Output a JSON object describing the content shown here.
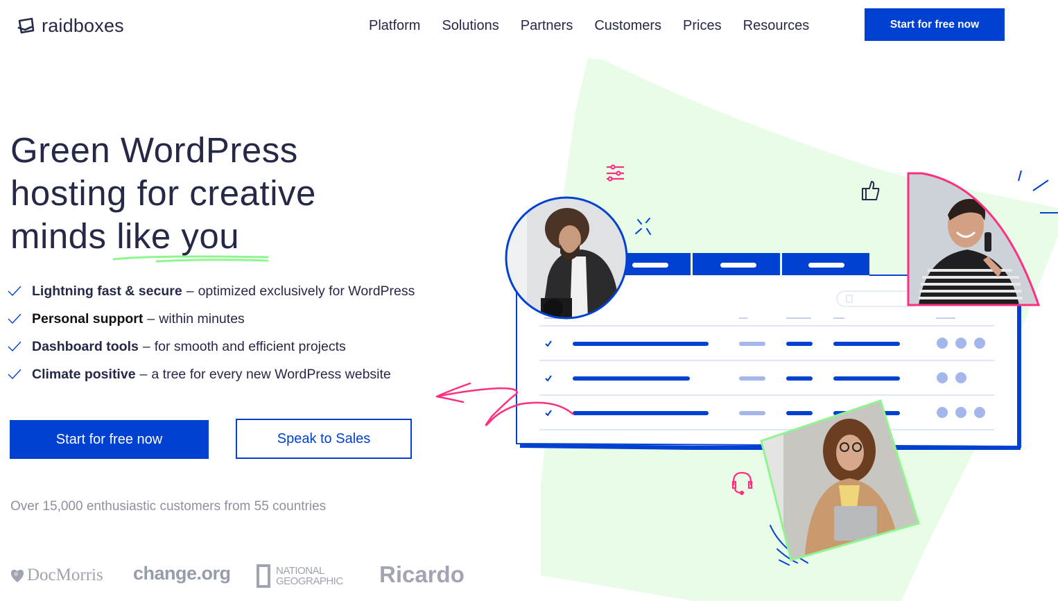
{
  "header": {
    "logo_text": "raidboxes",
    "nav": [
      {
        "label": "Platform"
      },
      {
        "label": "Solutions"
      },
      {
        "label": "Partners"
      },
      {
        "label": "Customers"
      },
      {
        "label": "Prices"
      },
      {
        "label": "Resources"
      }
    ],
    "cta_label": "Start for free now"
  },
  "hero": {
    "title_line1": "Green WordPress",
    "title_line2": "hosting for creative",
    "title_line3_a": "minds ",
    "title_line3_b": "like you",
    "features": [
      {
        "bold": "Lightning fast & secure",
        "rest": "optimized exclusively for WordPress"
      },
      {
        "bold": "Personal support",
        "rest": "within minutes"
      },
      {
        "bold": "Dashboard tools",
        "rest": "for smooth and efficient projects"
      },
      {
        "bold": "Climate positive",
        "rest": "a tree for every new WordPress website"
      }
    ],
    "feature_separator": "–",
    "primary_button": "Start for free now",
    "secondary_button": "Speak to Sales",
    "customers_note": "Over 15,000 enthusiastic customers from 55 countries"
  },
  "customer_logos": {
    "docmorris": "DocMorris",
    "change": "change.org",
    "natgeo_line1": "NATIONAL",
    "natgeo_line2": "GEOGRAPHIC",
    "ricardo": "Ricardo"
  },
  "illustration": {
    "icons": [
      "sliders-icon",
      "thumbs-up-icon",
      "sparkle-icon",
      "headset-icon",
      "arrow-scribble"
    ],
    "dashboard_rows": [
      {
        "checked": true,
        "status_dots": 3
      },
      {
        "checked": true,
        "status_dots": 2
      },
      {
        "checked": true,
        "status_dots": 3
      }
    ],
    "dashboard_tabs": 3
  },
  "colors": {
    "brand_blue": "#0041d1",
    "text_dark": "#252847",
    "accent_pink": "#ff2f7f",
    "accent_green": "#8ff58f",
    "blob_green": "#e8fce8",
    "muted_gray": "#8e8f9f"
  }
}
